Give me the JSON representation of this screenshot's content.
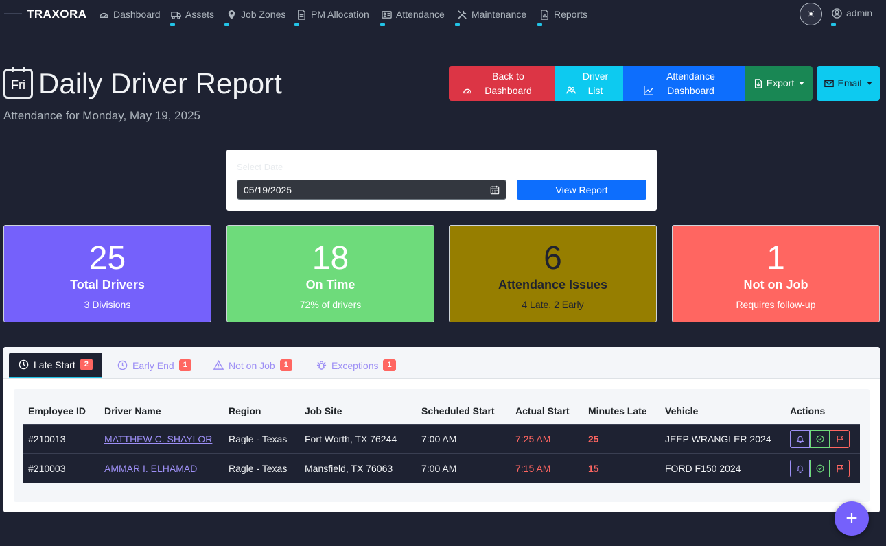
{
  "nav": {
    "brand": "TRAXORA",
    "items": [
      {
        "label": "Dashboard",
        "icon": "speedometer-icon"
      },
      {
        "label": "Assets",
        "icon": "truck-icon"
      },
      {
        "label": "Job Zones",
        "icon": "map-pin-icon"
      },
      {
        "label": "PM Allocation",
        "icon": "file-icon"
      },
      {
        "label": "Attendance",
        "icon": "id-card-icon"
      },
      {
        "label": "Maintenance",
        "icon": "tools-icon"
      },
      {
        "label": "Reports",
        "icon": "report-icon"
      }
    ],
    "theme_toggle_icon": "sun-icon",
    "user": "admin"
  },
  "header": {
    "calendar_day": "Fri",
    "title": "Daily Driver Report",
    "subtitle": "Attendance for Monday, May 19, 2025"
  },
  "actions": {
    "back": "Back to Dashboard",
    "driver_list": "Driver List",
    "attendance_dashboard": "Attendance Dashboard",
    "export": "Export",
    "email": "Email"
  },
  "date_picker": {
    "label": "Select Date",
    "value": "05/19/2025",
    "submit": "View Report"
  },
  "stats": [
    {
      "value": "25",
      "label": "Total Drivers",
      "sub": "3 Divisions",
      "color": "#7561fb"
    },
    {
      "value": "18",
      "label": "On Time",
      "sub": "72% of drivers",
      "color": "#6edb7b"
    },
    {
      "value": "6",
      "label": "Attendance Issues",
      "sub": "4 Late, 2 Early",
      "color": "#967e00"
    },
    {
      "value": "1",
      "label": "Not on Job",
      "sub": "Requires follow-up",
      "color": "#ff6661"
    }
  ],
  "tabs": [
    {
      "label": "Late Start",
      "count": "2",
      "icon": "clock-icon"
    },
    {
      "label": "Early End",
      "count": "1",
      "icon": "clock-icon"
    },
    {
      "label": "Not on Job",
      "count": "1",
      "icon": "warning-icon"
    },
    {
      "label": "Exceptions",
      "count": "1",
      "icon": "bug-icon"
    }
  ],
  "table": {
    "headers": [
      "Employee ID",
      "Driver Name",
      "Region",
      "Job Site",
      "Scheduled Start",
      "Actual Start",
      "Minutes Late",
      "Vehicle",
      "Actions"
    ],
    "rows": [
      {
        "id": "#210013",
        "name": "MATTHEW C. SHAYLOR",
        "region": "Ragle - Texas",
        "site": "Fort Worth, TX 76244",
        "scheduled": "7:00 AM",
        "actual": "7:25 AM",
        "late": "25",
        "vehicle": "JEEP WRANGLER 2024"
      },
      {
        "id": "#210003",
        "name": "AMMAR I. ELHAMAD",
        "region": "Ragle - Texas",
        "site": "Mansfield, TX 76063",
        "scheduled": "7:00 AM",
        "actual": "7:15 AM",
        "late": "15",
        "vehicle": "FORD F150 2024"
      }
    ]
  },
  "fab": "+"
}
